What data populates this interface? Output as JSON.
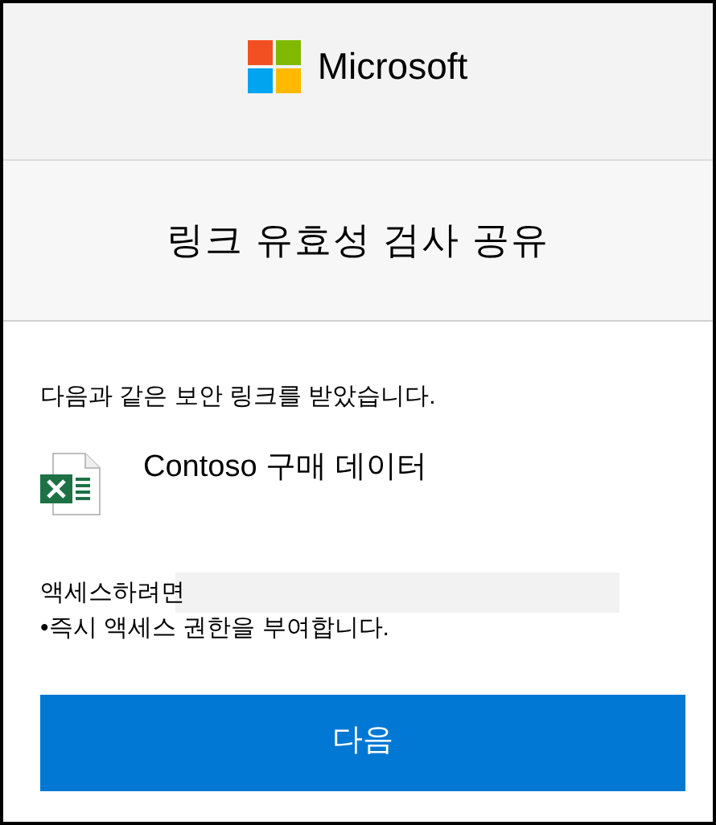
{
  "header": {
    "brand": "Microsoft"
  },
  "title": "링크 유효성 검사 공유",
  "message": "다음과 같은 보안 링크를 받았습니다.",
  "file": {
    "kind": "spreadsheet",
    "name": "Contoso 구매 데이터"
  },
  "access_label": "액세스하려면",
  "access_note": "•즉시 액세스 권한을 부여합니다.",
  "button": "다음"
}
